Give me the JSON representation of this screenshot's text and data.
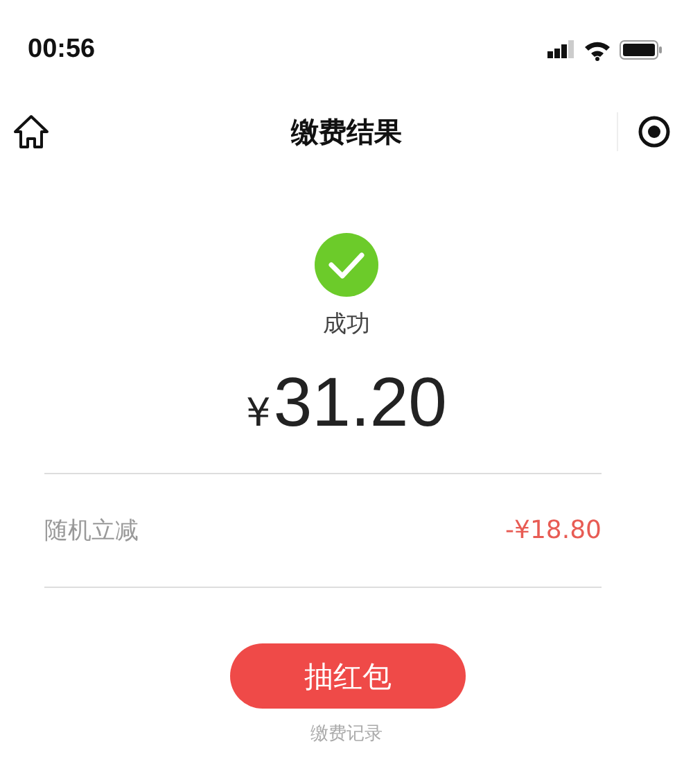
{
  "status_bar": {
    "time": "00:56"
  },
  "nav_bar": {
    "title": "缴费结果"
  },
  "result": {
    "status": "成功",
    "currency": "¥",
    "amount": "31.20"
  },
  "details": [
    {
      "label": "随机立减",
      "value": "-¥18.80"
    }
  ],
  "action_button": "抽红包",
  "records_link": "缴费记录"
}
